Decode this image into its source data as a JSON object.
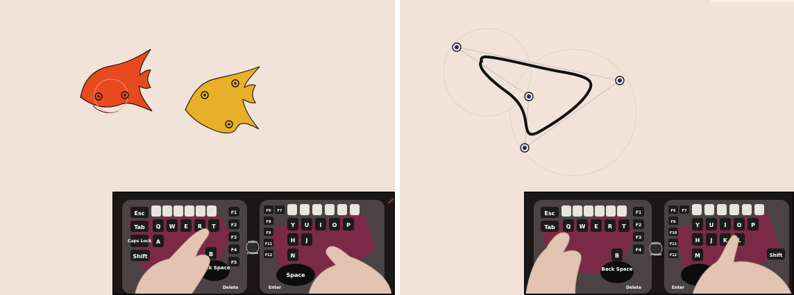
{
  "left_panel": {
    "fish": [
      {
        "name": "red-fish",
        "color": "#e84a1f"
      },
      {
        "name": "yellow-fish",
        "color": "#e8b02a"
      }
    ]
  },
  "right_panel": {
    "curve_color": "#111111",
    "handle_color": "#1d2b6b"
  },
  "keyboard": {
    "left_keys": {
      "esc": "Esc",
      "tab": "Tab",
      "caps": "Caps Lock",
      "shift": "Shift",
      "q": "Q",
      "w": "W",
      "e": "E",
      "r": "R",
      "t": "T",
      "a": "A",
      "b": "B",
      "f1": "F1",
      "f2": "F2",
      "f3": "F3",
      "f4": "F4",
      "f5": "F5",
      "backspace": "Back Space",
      "delete": "Delete"
    },
    "right_keys": {
      "f6": "F6",
      "f7": "F7",
      "f8": "F8",
      "f9": "F9",
      "f10": "F10",
      "f11": "F11",
      "f12": "F12",
      "y": "Y",
      "u": "U",
      "i": "I",
      "o": "O",
      "p": "P",
      "h": "H",
      "j": "J",
      "k": "K",
      "l": "L",
      "n": "N",
      "m": "M",
      "space": "Space",
      "enter": "Enter",
      "shift": "Shift"
    },
    "brand": "TOUCH STREAM"
  },
  "colors": {
    "background": "#f1e3da",
    "keyboard_body": "#4a4244",
    "keyboard_pad": "#7a2a46",
    "key": "#1b1b1b"
  }
}
